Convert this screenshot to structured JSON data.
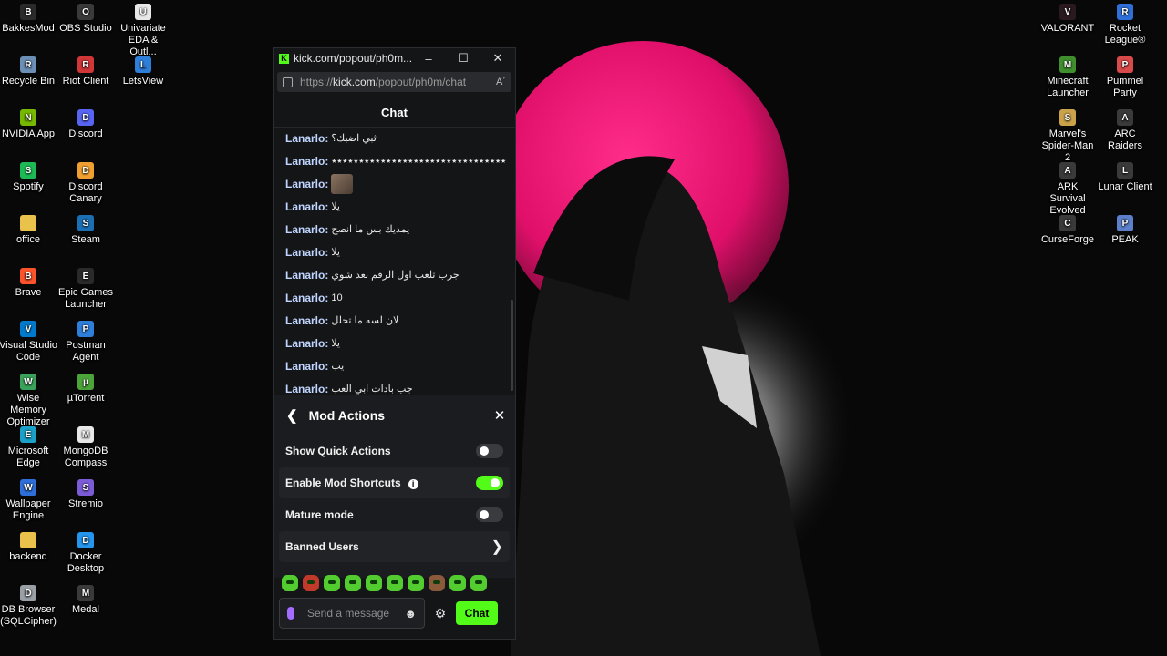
{
  "desktop": {
    "left_icons": [
      {
        "label": "BakkesMod",
        "glyph": "B",
        "color": "#2b2b2b"
      },
      {
        "label": "OBS Studio",
        "glyph": "O",
        "color": "#3a3a3a"
      },
      {
        "label": "Univariate EDA & Outl...",
        "glyph": "U",
        "color": "#e8e8e8"
      },
      {
        "label": "Recycle Bin",
        "glyph": "R",
        "color": "#6b8fb5"
      },
      {
        "label": "Riot Client",
        "glyph": "R",
        "color": "#d13639"
      },
      {
        "label": "LetsView",
        "glyph": "L",
        "color": "#2e7fd9"
      },
      {
        "label": "NVIDIA App",
        "glyph": "N",
        "color": "#76b900"
      },
      {
        "label": "Discord",
        "glyph": "D",
        "color": "#5865f2"
      },
      {
        "label": "Spotify",
        "glyph": "S",
        "color": "#1db954"
      },
      {
        "label": "Discord Canary",
        "glyph": "D",
        "color": "#f0a030"
      },
      {
        "label": "office",
        "glyph": "",
        "color": "#e8c24a"
      },
      {
        "label": "Steam",
        "glyph": "S",
        "color": "#1b6fb5"
      },
      {
        "label": "Brave",
        "glyph": "B",
        "color": "#fb542b"
      },
      {
        "label": "Epic Games Launcher",
        "glyph": "E",
        "color": "#2a2a2a"
      },
      {
        "label": "Visual Studio Code",
        "glyph": "V",
        "color": "#007acc"
      },
      {
        "label": "Postman Agent",
        "glyph": "P",
        "color": "#2e7fd9"
      },
      {
        "label": "Wise Memory Optimizer",
        "glyph": "W",
        "color": "#3aa35a"
      },
      {
        "label": "µTorrent",
        "glyph": "µ",
        "color": "#4ba33a"
      },
      {
        "label": "Microsoft Edge",
        "glyph": "E",
        "color": "#1ba0c8"
      },
      {
        "label": "MongoDB Compass",
        "glyph": "M",
        "color": "#e8e8e8"
      },
      {
        "label": "Wallpaper Engine",
        "glyph": "W",
        "color": "#2e6fd9"
      },
      {
        "label": "Stremio",
        "glyph": "S",
        "color": "#7b5bd6"
      },
      {
        "label": "backend",
        "glyph": "",
        "color": "#e8c24a"
      },
      {
        "label": "Docker Desktop",
        "glyph": "D",
        "color": "#2496ed"
      },
      {
        "label": "DB Browser (SQLCipher)",
        "glyph": "D",
        "color": "#9aa0a6"
      },
      {
        "label": "Medal",
        "glyph": "M",
        "color": "#3a3a3a"
      }
    ],
    "right_icons": [
      {
        "label": "VALORANT",
        "glyph": "V",
        "color": "#2a1a1f"
      },
      {
        "label": "Rocket League®",
        "glyph": "R",
        "color": "#2e6fd9"
      },
      {
        "label": "Minecraft Launcher",
        "glyph": "M",
        "color": "#3f8f2f"
      },
      {
        "label": "Pummel Party",
        "glyph": "P",
        "color": "#d94a4a"
      },
      {
        "label": "Marvel's Spider-Man 2",
        "glyph": "S",
        "color": "#c9a24a"
      },
      {
        "label": "ARC Raiders",
        "glyph": "A",
        "color": "#3a3a3a"
      },
      {
        "label": "ARK Survival Evolved",
        "glyph": "A",
        "color": "#3a3a3a"
      },
      {
        "label": "Lunar Client",
        "glyph": "L",
        "color": "#3a3a3a"
      },
      {
        "label": "CurseForge",
        "glyph": "C",
        "color": "#3a3a3a"
      },
      {
        "label": "PEAK",
        "glyph": "P",
        "color": "#5b7fc9"
      }
    ]
  },
  "browser": {
    "tab_title": "kick.com/popout/ph0m...",
    "url_prefix": "https://",
    "url_host": "kick.com",
    "url_path": "/popout/ph0m/chat",
    "minimize": "–",
    "maximize": "☐",
    "close": "✕",
    "reader": "A´"
  },
  "chat": {
    "header": "Chat",
    "messages": [
      {
        "user": "Lanarlo:",
        "text": "ثبي اضبك؟"
      },
      {
        "user": "Lanarlo:",
        "text": "٭٭٭٭٭٭٭٭٭٭٭٭٭٭٭٭٭٭٭٭٭٭٭٭٭٭٭٭٭٭٭٭"
      },
      {
        "user": "Lanarlo:",
        "text": "",
        "emote": true
      },
      {
        "user": "Lanarlo:",
        "text": "يلا"
      },
      {
        "user": "Lanarlo:",
        "text": "يمديك بس ما انصح"
      },
      {
        "user": "Lanarlo:",
        "text": "يلا"
      },
      {
        "user": "Lanarlo:",
        "text": "جرب تلعب اول الرقم بعد شوي"
      },
      {
        "user": "Lanarlo:",
        "text": "10"
      },
      {
        "user": "Lanarlo:",
        "text": "لان لسه ما تحلل"
      },
      {
        "user": "Lanarlo:",
        "text": "يلا"
      },
      {
        "user": "Lanarlo:",
        "text": "يب"
      },
      {
        "user": "Lanarlo:",
        "text": "جب بادات ابي العب"
      }
    ],
    "mod_actions": {
      "title": "Mod Actions",
      "rows": [
        {
          "label": "Show Quick Actions",
          "enabled": false
        },
        {
          "label": "Enable Mod Shortcuts",
          "enabled": true,
          "info": "i"
        },
        {
          "label": "Mature mode",
          "enabled": false
        },
        {
          "label": "Banned Users"
        }
      ]
    },
    "input": {
      "placeholder": "Send a message",
      "send_label": "Chat"
    },
    "accent_color": "#53fc18"
  }
}
